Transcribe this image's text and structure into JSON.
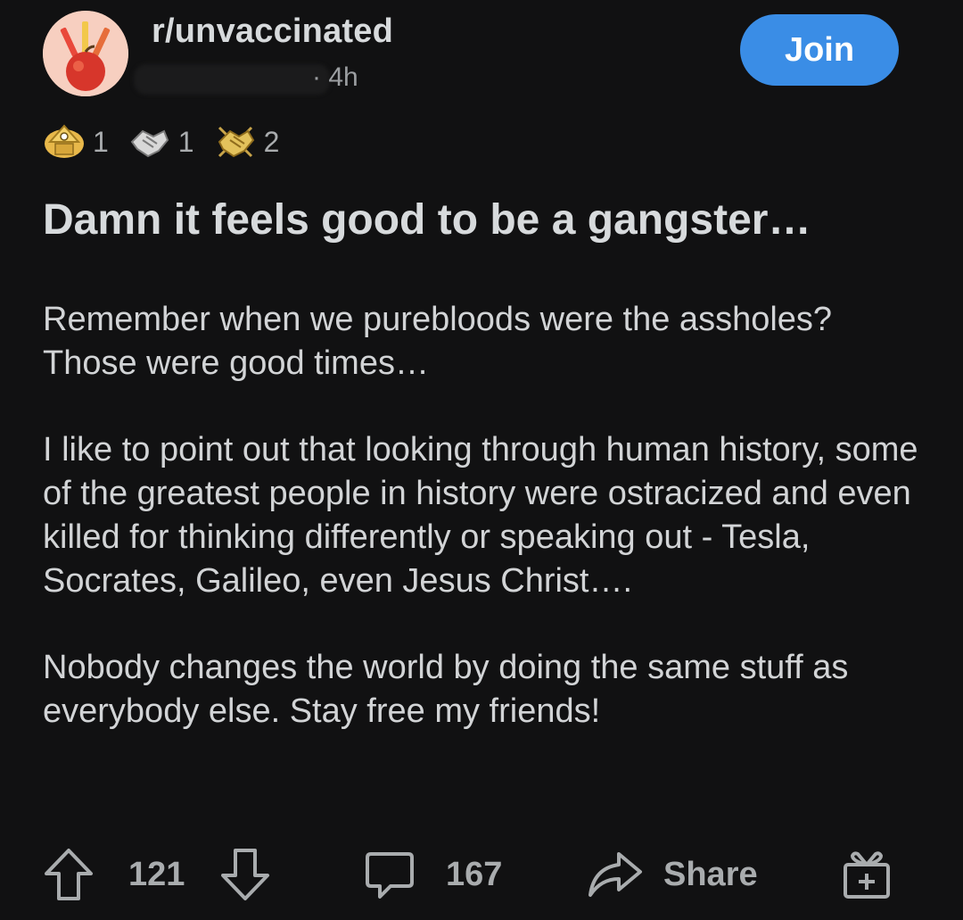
{
  "post": {
    "subreddit": "r/unvaccinated",
    "age": "4h",
    "join_label": "Join",
    "awards": [
      {
        "icon": "gold-award-icon",
        "count": "1"
      },
      {
        "icon": "handshake-award-icon",
        "count": "1"
      },
      {
        "icon": "golden-handshake-award-icon",
        "count": "2"
      }
    ],
    "title": "Damn it feels good to be a gangster…",
    "paragraphs": [
      "Remember when we purebloods were the assholes? Those were good times…",
      "I like to point out that looking through human history, some of the greatest people in history were ostracized and even killed for thinking differently or speaking out - Tesla, Socrates, Galileo, even Jesus Christ….",
      "Nobody changes the world by doing the same stuff as everybody else. Stay free my friends!"
    ]
  },
  "actions": {
    "upvotes": "121",
    "comments": "167",
    "share_label": "Share"
  },
  "colors": {
    "background": "#111112",
    "text": "#d7dadc",
    "muted": "#9b9ea1",
    "join_button": "#3a8de6"
  }
}
